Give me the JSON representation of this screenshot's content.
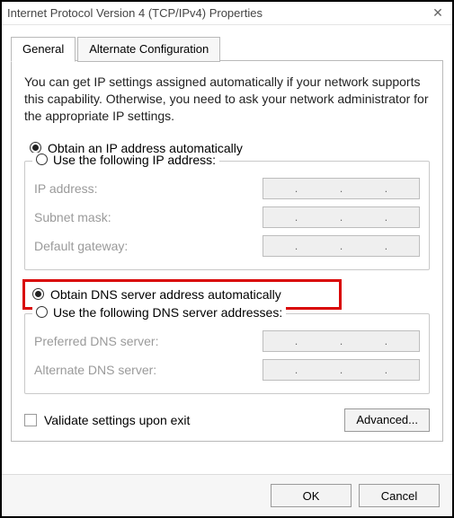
{
  "window": {
    "title": "Internet Protocol Version 4 (TCP/IPv4) Properties"
  },
  "tabs": {
    "general": "General",
    "alternate": "Alternate Configuration"
  },
  "description": "You can get IP settings assigned automatically if your network supports this capability. Otherwise, you need to ask your network administrator for the appropriate IP settings.",
  "ip": {
    "auto_label": "Obtain an IP address automatically",
    "manual_label": "Use the following IP address:",
    "fields": {
      "address": "IP address:",
      "subnet": "Subnet mask:",
      "gateway": "Default gateway:"
    }
  },
  "dns": {
    "auto_label": "Obtain DNS server address automatically",
    "manual_label": "Use the following DNS server addresses:",
    "fields": {
      "preferred": "Preferred DNS server:",
      "alternate": "Alternate DNS server:"
    }
  },
  "validate_label": "Validate settings upon exit",
  "buttons": {
    "advanced": "Advanced...",
    "ok": "OK",
    "cancel": "Cancel"
  }
}
